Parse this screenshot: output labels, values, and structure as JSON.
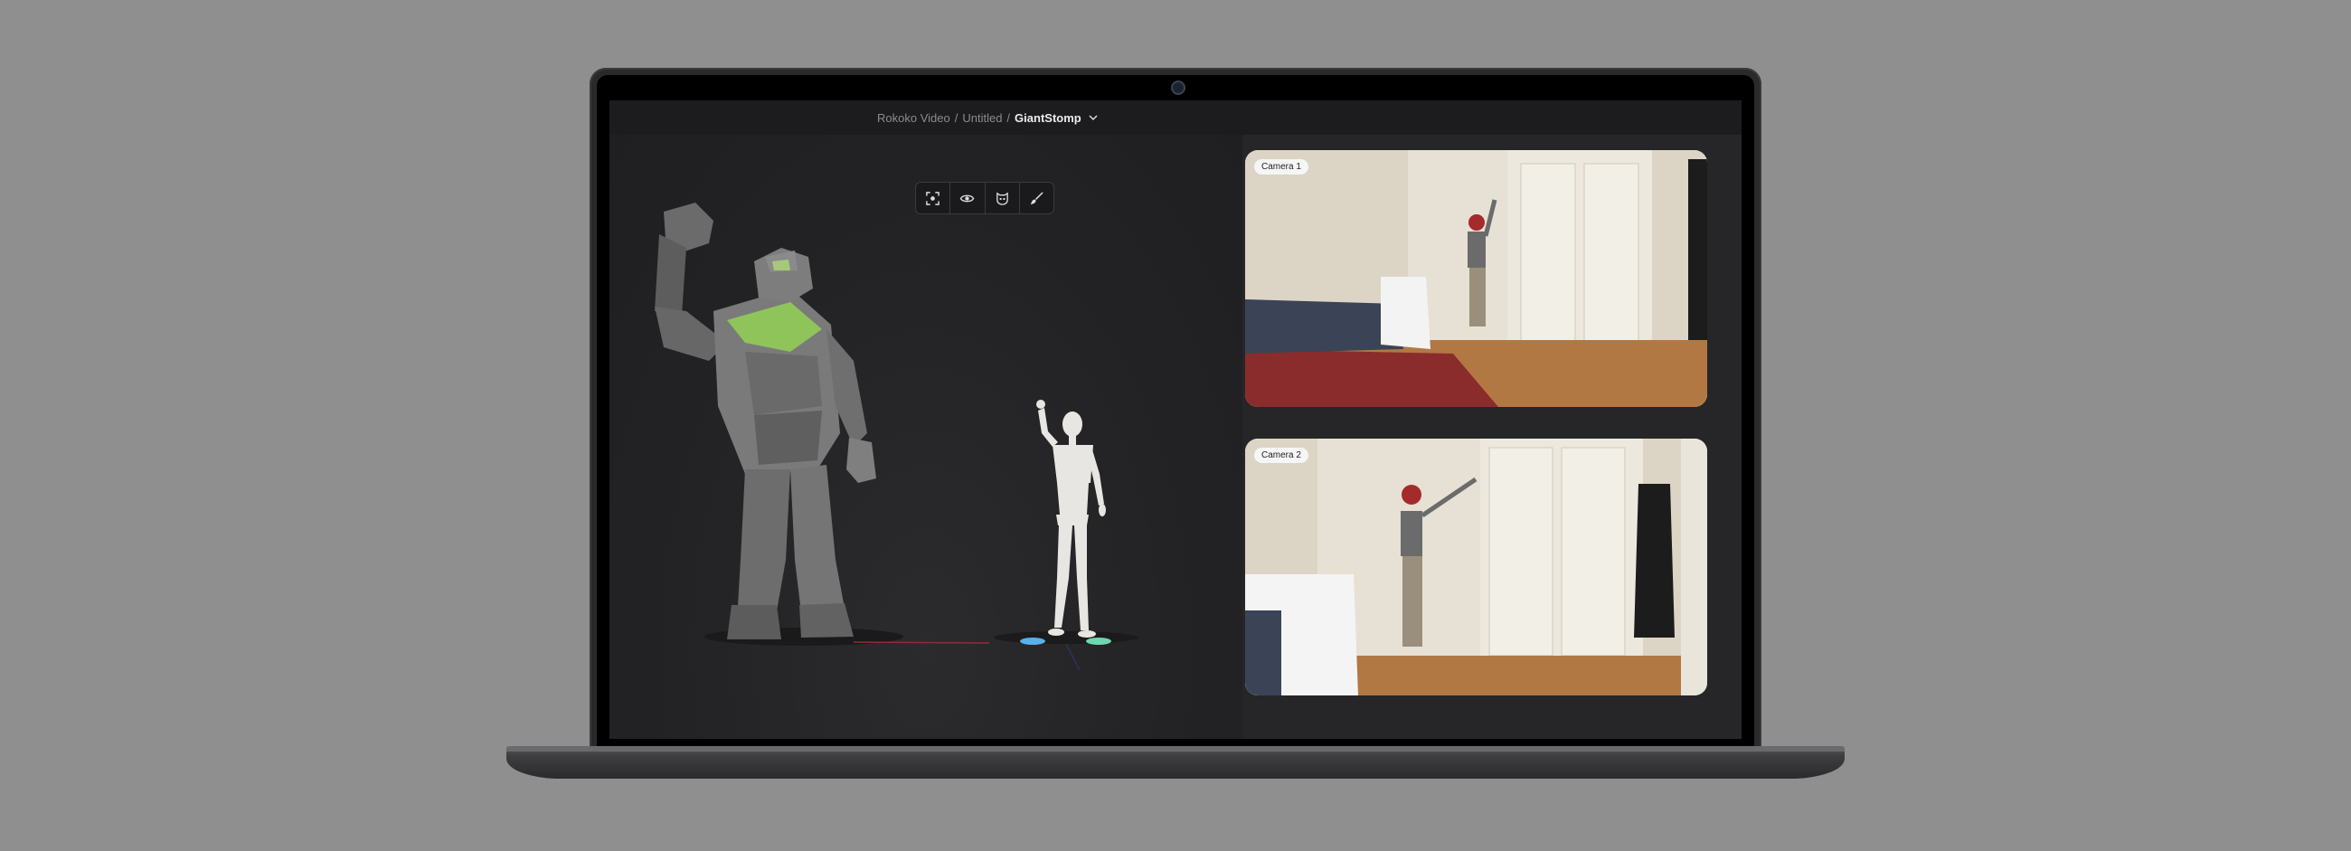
{
  "breadcrumb": {
    "items": [
      "Rokoko Video",
      "Untitled"
    ],
    "separator": "/",
    "current": "GiantStomp"
  },
  "toolbar": {
    "tools": [
      {
        "icon": "focus-frame-icon"
      },
      {
        "icon": "eye-icon"
      },
      {
        "icon": "character-mask-icon"
      },
      {
        "icon": "brush-icon"
      }
    ]
  },
  "cameras": [
    {
      "label": "Camera 1"
    },
    {
      "label": "Camera 2"
    }
  ],
  "colors": {
    "accent_green": "#8fc45a",
    "foot_marker_blue": "#5ab0e8",
    "foot_marker_green": "#6fd6b0",
    "app_background": "#242426"
  }
}
